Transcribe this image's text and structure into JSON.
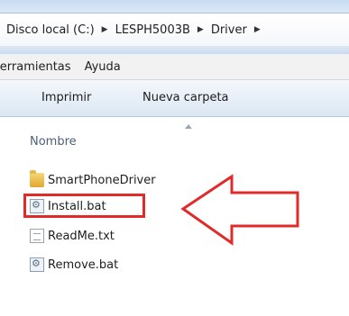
{
  "address": {
    "crumbs": [
      "Disco local (C:)",
      "LESPH5003B",
      "Driver"
    ]
  },
  "menu": {
    "items": [
      "Herramientas",
      "Ayuda"
    ]
  },
  "toolbar": {
    "print_label": "Imprimir",
    "new_folder_label": "Nueva carpeta"
  },
  "list": {
    "column_name": "Nombre",
    "files": [
      {
        "name": "SmartPhoneDriver",
        "icon": "folder-icon"
      },
      {
        "name": "Install.bat",
        "icon": "bat-file-icon"
      },
      {
        "name": "ReadMe.txt",
        "icon": "text-file-icon"
      },
      {
        "name": "Remove.bat",
        "icon": "bat-file-icon"
      }
    ]
  },
  "annotation": {
    "highlight_color": "#e12a2a",
    "arrow_color": "#e12a2a",
    "target": "Install.bat"
  }
}
